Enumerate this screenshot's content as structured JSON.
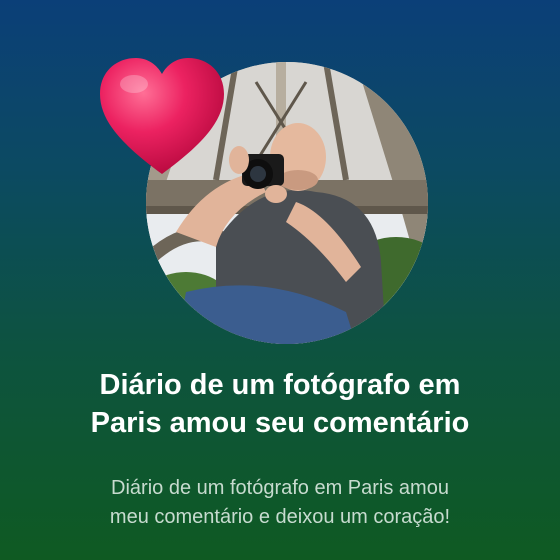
{
  "notification": {
    "title_line1": "Diário de um fotógrafo em",
    "title_line2": "Paris amou seu comentário",
    "body_line1": "Diário de um fotógrafo em Paris amou",
    "body_line2": "meu comentário e deixou um coração!"
  },
  "icons": {
    "reaction": "heart-icon"
  },
  "colors": {
    "background_top": "#0b3f78",
    "background_bottom": "#0f5a22",
    "heart": "#e8195a",
    "title": "#ffffff",
    "body": "#c7dbcf"
  }
}
